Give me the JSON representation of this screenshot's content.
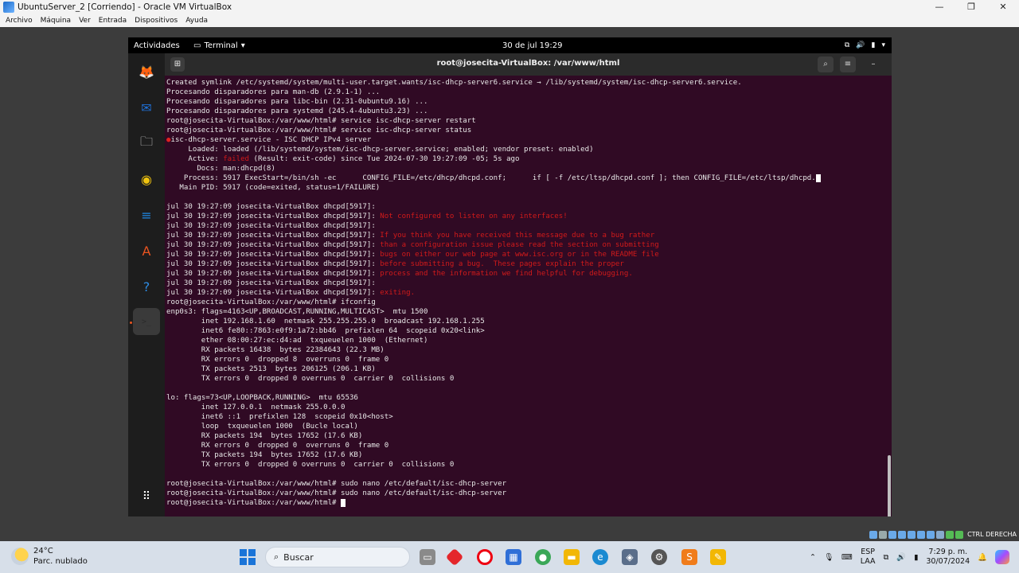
{
  "host": {
    "title": "UbuntuServer_2 [Corriendo] - Oracle VM VirtualBox",
    "menu": [
      "Archivo",
      "Máquina",
      "Ver",
      "Entrada",
      "Dispositivos",
      "Ayuda"
    ],
    "controls": [
      "—",
      "❐",
      "✕"
    ],
    "host_key": "CTRL DERECHA"
  },
  "guest_topbar": {
    "activities": "Actividades",
    "app": "Terminal",
    "clock": "30 de jul  19:29"
  },
  "terminal": {
    "title": "root@josecita-VirtualBox: /var/www/html",
    "lines": [
      {
        "t": "Created symlink /etc/systemd/system/multi-user.target.wants/isc-dhcp-server6.service → /lib/systemd/system/isc-dhcp-server6.service."
      },
      {
        "t": "Procesando disparadores para man-db (2.9.1-1) ..."
      },
      {
        "t": "Procesando disparadores para libc-bin (2.31-0ubuntu9.16) ..."
      },
      {
        "t": "Procesando disparadores para systemd (245.4-4ubuntu3.23) ..."
      },
      {
        "t": "root@josecita-VirtualBox:/var/www/html# service isc-dhcp-server restart"
      },
      {
        "t": "root@josecita-VirtualBox:/var/www/html# service isc-dhcp-server status"
      },
      {
        "b": "●",
        "t": "isc-dhcp-server.service - ISC DHCP IPv4 server"
      },
      {
        "t": "     Loaded: loaded (/lib/systemd/system/isc-dhcp-server.service; enabled; vendor preset: enabled)"
      },
      {
        "t": "     Active: ",
        "r": "failed",
        "t2": " (Result: exit-code) since Tue 2024-07-30 19:27:09 -05; 5s ago"
      },
      {
        "t": "       Docs: man:dhcpd(8)"
      },
      {
        "t": "    Process: 5917 ExecStart=/bin/sh -ec      CONFIG_FILE=/etc/dhcp/dhcpd.conf;      if [ -f /etc/ltsp/dhcpd.conf ]; then CONFIG_FILE=/etc/ltsp/dhcpd.",
        "cur": true
      },
      {
        "t": "   Main PID: 5917 (code=exited, status=1/FAILURE)"
      },
      {
        "t": ""
      },
      {
        "t": "jul 30 19:27:09 josecita-VirtualBox dhcpd[5917]: "
      },
      {
        "t": "jul 30 19:27:09 josecita-VirtualBox dhcpd[5917]: ",
        "r": "Not configured to listen on any interfaces!"
      },
      {
        "t": "jul 30 19:27:09 josecita-VirtualBox dhcpd[5917]: "
      },
      {
        "t": "jul 30 19:27:09 josecita-VirtualBox dhcpd[5917]: ",
        "r": "If you think you have received this message due to a bug rather"
      },
      {
        "t": "jul 30 19:27:09 josecita-VirtualBox dhcpd[5917]: ",
        "r": "than a configuration issue please read the section on submitting"
      },
      {
        "t": "jul 30 19:27:09 josecita-VirtualBox dhcpd[5917]: ",
        "r": "bugs on either our web page at www.isc.org or in the README file"
      },
      {
        "t": "jul 30 19:27:09 josecita-VirtualBox dhcpd[5917]: ",
        "r": "before submitting a bug.  These pages explain the proper"
      },
      {
        "t": "jul 30 19:27:09 josecita-VirtualBox dhcpd[5917]: ",
        "r": "process and the information we find helpful for debugging."
      },
      {
        "t": "jul 30 19:27:09 josecita-VirtualBox dhcpd[5917]: "
      },
      {
        "t": "jul 30 19:27:09 josecita-VirtualBox dhcpd[5917]: ",
        "r": "exiting."
      },
      {
        "t": "root@josecita-VirtualBox:/var/www/html# ifconfig"
      },
      {
        "t": "enp0s3: flags=4163<UP,BROADCAST,RUNNING,MULTICAST>  mtu 1500"
      },
      {
        "t": "        inet 192.168.1.60  netmask 255.255.255.0  broadcast 192.168.1.255"
      },
      {
        "t": "        inet6 fe80::7863:e0f9:1a72:bb46  prefixlen 64  scopeid 0x20<link>"
      },
      {
        "t": "        ether 08:00:27:ec:d4:ad  txqueuelen 1000  (Ethernet)"
      },
      {
        "t": "        RX packets 16438  bytes 22384643 (22.3 MB)"
      },
      {
        "t": "        RX errors 0  dropped 8  overruns 0  frame 0"
      },
      {
        "t": "        TX packets 2513  bytes 206125 (206.1 KB)"
      },
      {
        "t": "        TX errors 0  dropped 0 overruns 0  carrier 0  collisions 0"
      },
      {
        "t": ""
      },
      {
        "t": "lo: flags=73<UP,LOOPBACK,RUNNING>  mtu 65536"
      },
      {
        "t": "        inet 127.0.0.1  netmask 255.0.0.0"
      },
      {
        "t": "        inet6 ::1  prefixlen 128  scopeid 0x10<host>"
      },
      {
        "t": "        loop  txqueuelen 1000  (Bucle local)"
      },
      {
        "t": "        RX packets 194  bytes 17652 (17.6 KB)"
      },
      {
        "t": "        RX errors 0  dropped 0  overruns 0  frame 0"
      },
      {
        "t": "        TX packets 194  bytes 17652 (17.6 KB)"
      },
      {
        "t": "        TX errors 0  dropped 0 overruns 0  carrier 0  collisions 0"
      },
      {
        "t": ""
      },
      {
        "t": "root@josecita-VirtualBox:/var/www/html# sudo nano /etc/default/isc-dhcp-server"
      },
      {
        "t": "root@josecita-VirtualBox:/var/www/html# sudo nano /etc/default/isc-dhcp-server"
      },
      {
        "t": "root@josecita-VirtualBox:/var/www/html# ",
        "cursor": true
      }
    ]
  },
  "dock": [
    {
      "name": "firefox-icon",
      "glyph": "🦊",
      "color": "#e66000"
    },
    {
      "name": "thunderbird-icon",
      "glyph": "✉",
      "color": "#1f6fd6"
    },
    {
      "name": "files-icon",
      "glyph": "🗀",
      "color": "#d9d9d9"
    },
    {
      "name": "rhythmbox-icon",
      "glyph": "◉",
      "color": "#f1c40f"
    },
    {
      "name": "writer-icon",
      "glyph": "≡",
      "color": "#1e88e5"
    },
    {
      "name": "software-icon",
      "glyph": "A",
      "color": "#e95420"
    },
    {
      "name": "help-icon",
      "glyph": "?",
      "color": "#2d8ae0"
    },
    {
      "name": "terminal-icon",
      "glyph": ">_",
      "color": "#2b2b2b"
    }
  ],
  "taskbar": {
    "weather_temp": "24°C",
    "weather_desc": "Parc. nublado",
    "search_placeholder": "Buscar",
    "lang": "ESP",
    "lang2": "LAA",
    "time": "7:29 p. m.",
    "date": "30/07/2024"
  }
}
